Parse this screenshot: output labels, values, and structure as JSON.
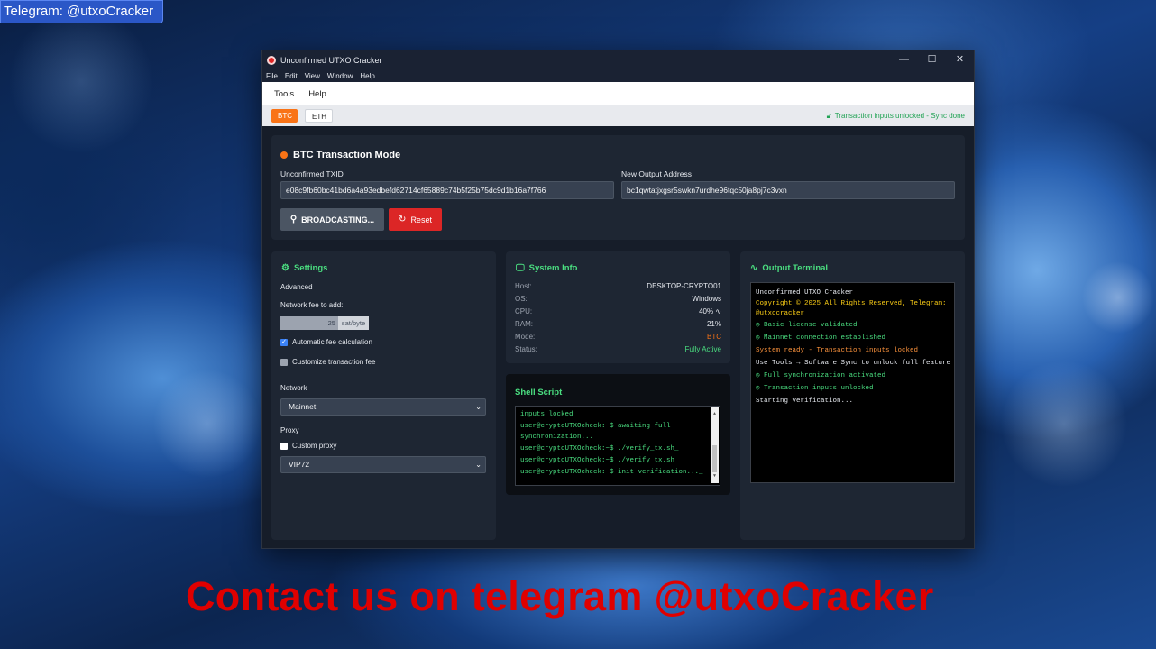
{
  "overlay": {
    "badge": "Telegram: @utxoCracker",
    "contact": "Contact us on telegram @utxoCracker"
  },
  "window": {
    "title": "Unconfirmed UTXO Cracker",
    "controls": {
      "minimize": "—",
      "maximize": "☐",
      "close": "✕"
    }
  },
  "menu": [
    "File",
    "Edit",
    "View",
    "Window",
    "Help"
  ],
  "toolbar": [
    "Tools",
    "Help"
  ],
  "tabs": {
    "btc": "BTC",
    "eth": "ETH"
  },
  "sync_status": "Transaction inputs unlocked - Sync done",
  "mode": {
    "title": "BTC Transaction Mode",
    "txid_label": "Unconfirmed TXID",
    "txid_value": "e08c9fb60bc41bd6a4a93edbefd62714cf65889c74b5f25b75dc9d1b16a7f766",
    "address_label": "New Output Address",
    "address_value": "bc1qwtatjxgsr5swkn7urdhe96tqc50ja8pj7c3vxn",
    "broadcast_label": "BROADCASTING...",
    "reset_label": "Reset"
  },
  "settings": {
    "title": "Settings",
    "advanced": "Advanced",
    "fee_label": "Network fee to add:",
    "fee_value": "25",
    "fee_unit": "sat/byte",
    "auto_fee": "Automatic fee calculation",
    "custom_fee": "Customize transaction fee",
    "network_label": "Network",
    "network_value": "Mainnet",
    "proxy_label": "Proxy",
    "custom_proxy": "Custom proxy",
    "proxy_value": "VIP72"
  },
  "system_info": {
    "title": "System Info",
    "rows": [
      {
        "key": "Host:",
        "value": "DESKTOP-CRYPTO01"
      },
      {
        "key": "OS:",
        "value": "Windows"
      },
      {
        "key": "CPU:",
        "value": "40% ∿"
      },
      {
        "key": "RAM:",
        "value": "21%"
      },
      {
        "key": "Mode:",
        "value": "BTC"
      },
      {
        "key": "Status:",
        "value": "Fully Active"
      }
    ],
    "mode_color": "#f97316",
    "status_color": "#4ade80"
  },
  "shell": {
    "title": "Shell Script",
    "lines": [
      "inputs locked",
      "user@cryptoUTXOcheck:~$ awaiting full synchronization...",
      "user@cryptoUTXOcheck:~$ ./verify_tx.sh_",
      "user@cryptoUTXOcheck:~$ ./verify_tx.sh_",
      "user@cryptoUTXOcheck:~$ init verification..._"
    ]
  },
  "terminal": {
    "title": "Output Terminal",
    "lines": [
      "Unconfirmed UTXO Cracker",
      "Copyright © 2025 All Rights Reserved, Telegram: @utxocracker",
      "Basic license validated",
      "Mainnet connection established",
      "System ready - Transaction inputs locked",
      "Use Tools → Software Sync to unlock full features",
      "Full synchronization activated",
      "Transaction inputs unlocked",
      "Starting verification..."
    ]
  }
}
